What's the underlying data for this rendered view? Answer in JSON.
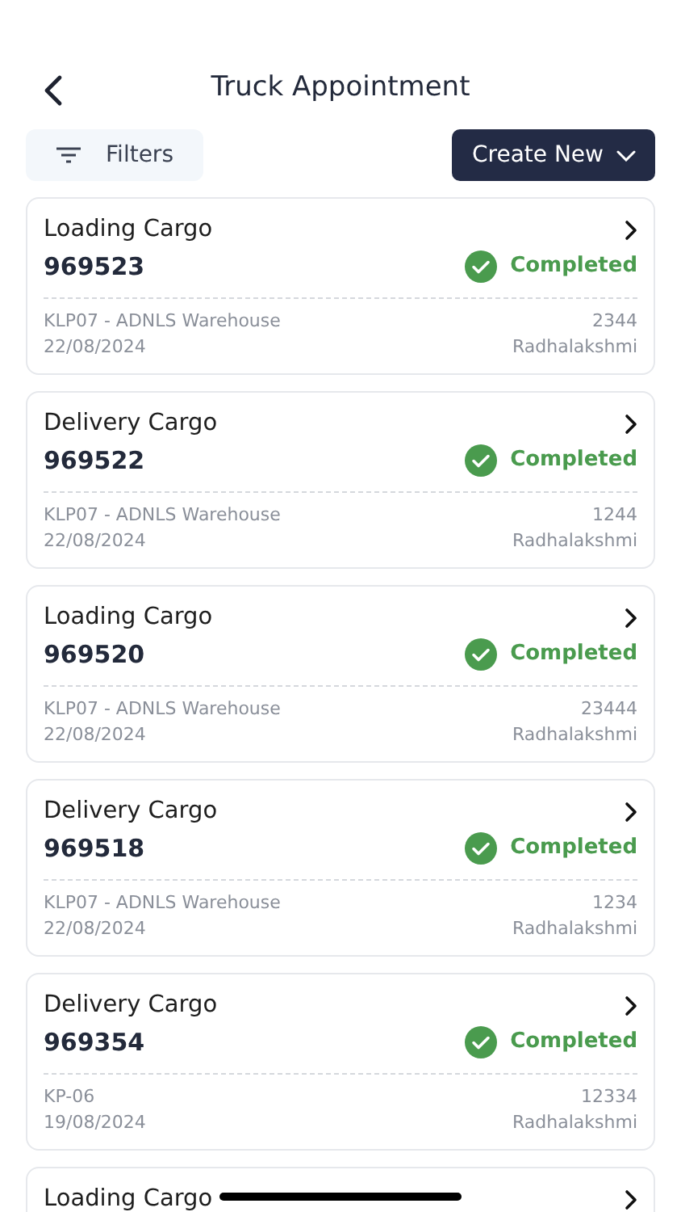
{
  "header": {
    "title": "Truck Appointment"
  },
  "toolbar": {
    "filters": "Filters",
    "create": "Create New"
  },
  "appointments": [
    {
      "type": "Loading Cargo",
      "number": "969523",
      "status": {
        "kind": "completed",
        "label": "Completed"
      },
      "location": "KLP07 - ADNLS Warehouse",
      "code": "2344",
      "date": "22/08/2024",
      "person": "Radhalakshmi"
    },
    {
      "type": "Delivery Cargo",
      "number": "969522",
      "status": {
        "kind": "completed",
        "label": "Completed"
      },
      "location": "KLP07 - ADNLS Warehouse",
      "code": "1244",
      "date": "22/08/2024",
      "person": "Radhalakshmi"
    },
    {
      "type": "Loading Cargo",
      "number": "969520",
      "status": {
        "kind": "completed",
        "label": "Completed"
      },
      "location": "KLP07 - ADNLS Warehouse",
      "code": "23444",
      "date": "22/08/2024",
      "person": "Radhalakshmi"
    },
    {
      "type": "Delivery Cargo",
      "number": "969518",
      "status": {
        "kind": "completed",
        "label": "Completed"
      },
      "location": "KLP07 - ADNLS Warehouse",
      "code": "1234",
      "date": "22/08/2024",
      "person": "Radhalakshmi"
    },
    {
      "type": "Delivery Cargo",
      "number": "969354",
      "status": {
        "kind": "completed",
        "label": "Completed"
      },
      "location": "KP-06",
      "code": "12334",
      "date": "19/08/2024",
      "person": "Radhalakshmi"
    },
    {
      "type": "Loading Cargo"
    }
  ]
}
